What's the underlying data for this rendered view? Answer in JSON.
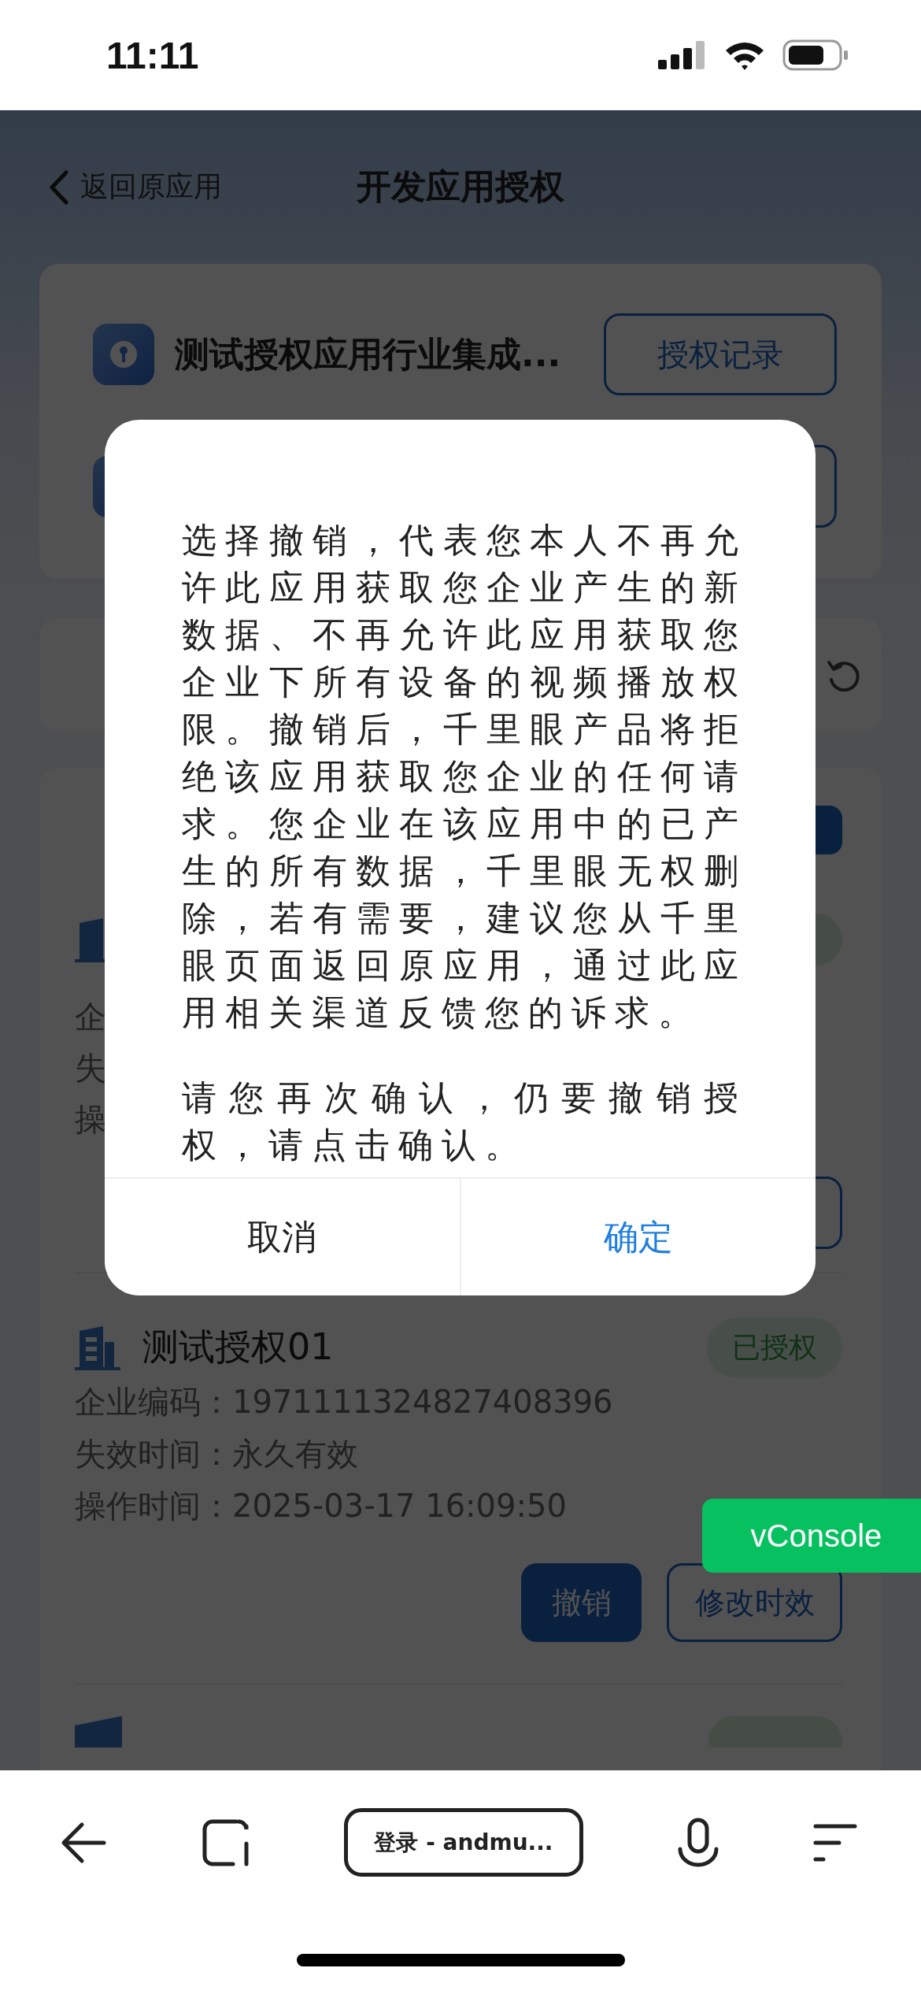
{
  "status_bar": {
    "time": "11:11"
  },
  "header": {
    "back_label": "返回原应用",
    "title": "开发应用授权"
  },
  "app_card": {
    "app_name": "测试授权应用行业集成...",
    "records_button": "授权记录"
  },
  "list": {
    "covered_item_labels": [
      "企",
      "失",
      "操"
    ],
    "item": {
      "name": "测试授权01",
      "status": "已授权",
      "fields": [
        {
          "label": "企业编码：",
          "value": "1971111324827408396"
        },
        {
          "label": "失效时间：",
          "value": "永久有效"
        },
        {
          "label": "操作时间：",
          "value": "2025-03-17 16:09:50"
        }
      ],
      "buttons": [
        {
          "label": "撤销",
          "kind": "primary"
        },
        {
          "label": "修改时效",
          "kind": "outline"
        }
      ]
    }
  },
  "dialog": {
    "paragraphs": [
      "选择撤销，代表您本人不再允许此应用获取您企业产生的新数据、不再允许此应用获取您企业下所有设备的视频播放权限。撤销后，千里眼产品将拒绝该应用获取您企业的任何请求。您企业在该应用中的已产生的所有数据，千里眼无权删除，若有需要，建议您从千里眼页面返回原应用，通过此应用相关渠道反馈您的诉求。",
      "请您再次确认，仍要撤销授权，请点击确认。"
    ],
    "buttons": [
      {
        "label": "取消",
        "kind": "cancel"
      },
      {
        "label": "确定",
        "kind": "confirm"
      }
    ]
  },
  "vconsole": "vConsole",
  "browser_bar": {
    "url_label": "登录 - andmu..."
  }
}
